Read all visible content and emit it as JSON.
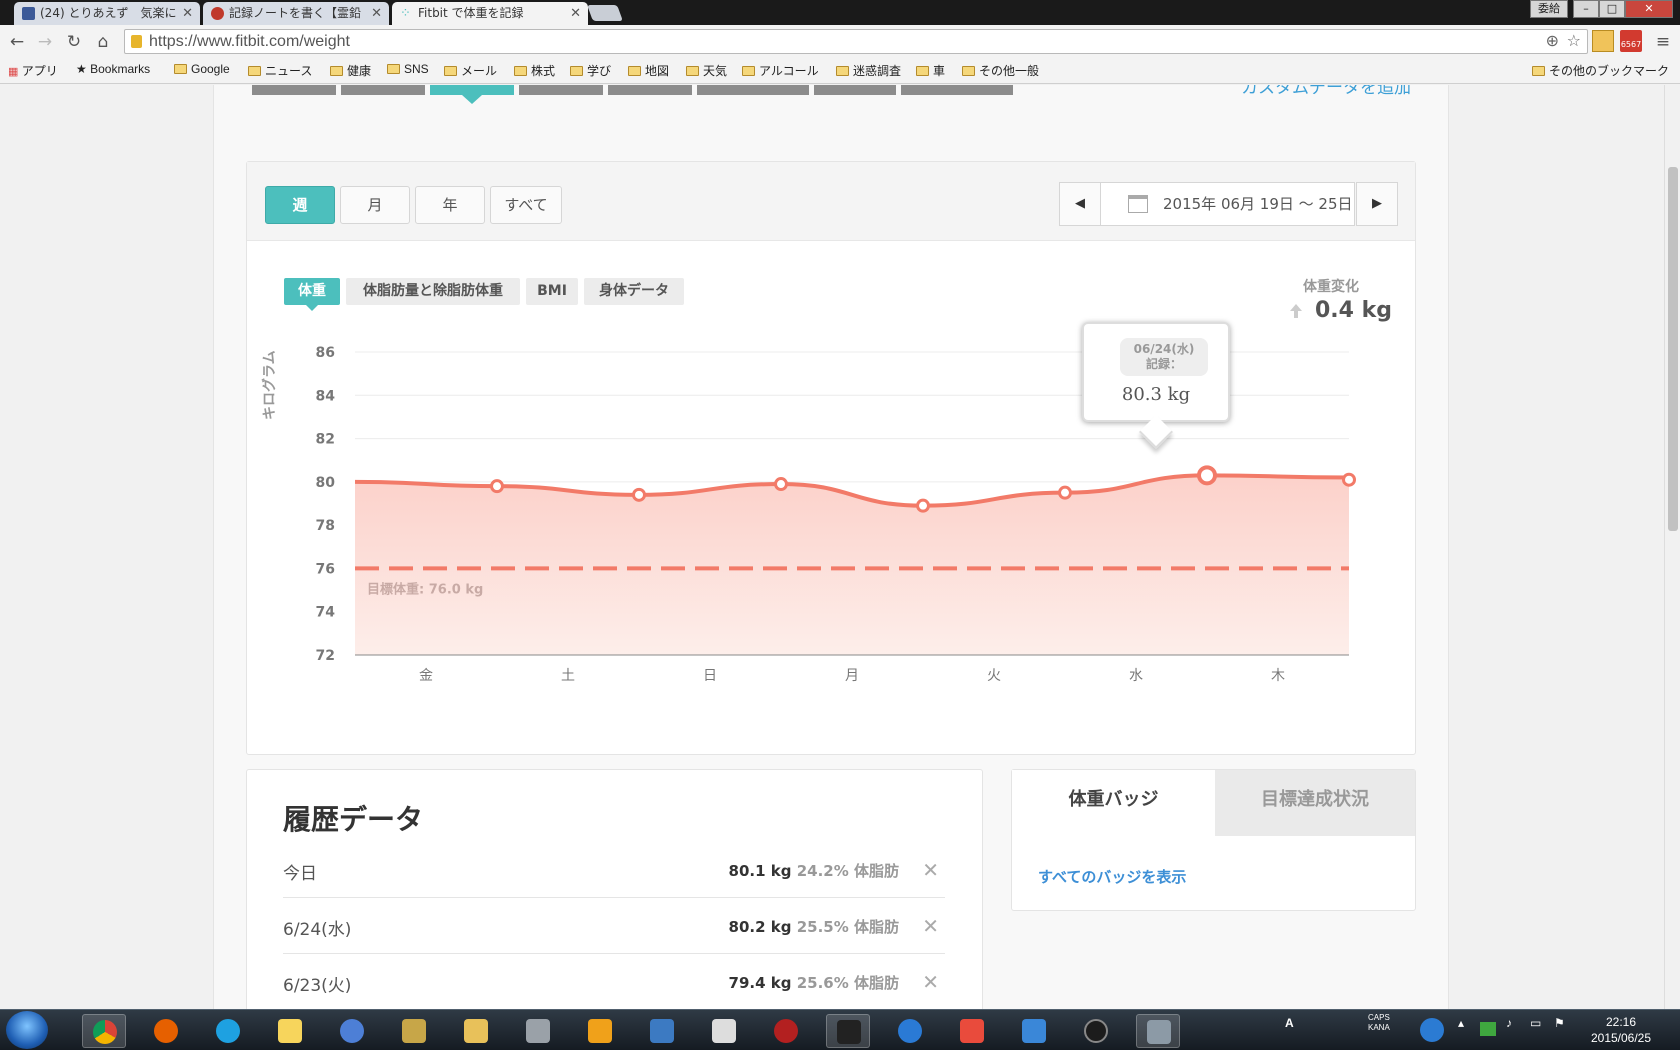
{
  "browser": {
    "tabs": [
      {
        "title": "(24) とりあえず　気楽に",
        "favicon_color": "#3b5998"
      },
      {
        "title": "記録ノートを書く【霊鉛",
        "favicon_color": "#c0392b"
      },
      {
        "title": "Fitbit で体重を記録",
        "favicon_color": "#4cbfbd"
      }
    ],
    "window_controls": {
      "ime": "委給",
      "minimize": "–",
      "maximize": "□",
      "close": "✕"
    },
    "url": "https://www.fitbit.com/weight",
    "gmail_badge": "6567",
    "bookmarks": [
      "アプリ",
      "Bookmarks",
      "Google",
      "ニュース",
      "健康",
      "SNS",
      "メール",
      "株式",
      "学び",
      "地図",
      "天気",
      "アルコール",
      "迷惑調査",
      "車",
      "その他一般"
    ],
    "other_bookmarks": "その他のブックマーク"
  },
  "page": {
    "custom_data_link": "カスタムデータを追加",
    "range_buttons": [
      "週",
      "月",
      "年",
      "すべて"
    ],
    "date_range": "2015年 06月 19日 ～ 25日",
    "prev_label": "◀",
    "next_label": "▶",
    "subtabs": [
      "体重",
      "体脂肪量と除脂肪体重",
      "BMI",
      "身体データ"
    ],
    "change_title": "体重変化",
    "change_value": "0.4 kg",
    "tooltip": {
      "date": "06/24(水)",
      "label": "記録：",
      "value": "80.3 kg"
    },
    "history": {
      "title": "履歴データ",
      "rows": [
        {
          "date": "今日",
          "weight": "80.1 kg",
          "fat": "24.2% 体脂肪"
        },
        {
          "date": "6/24(水)",
          "weight": "80.2 kg",
          "fat": "25.5% 体脂肪"
        },
        {
          "date": "6/23(火)",
          "weight": "79.4 kg",
          "fat": "25.6% 体脂肪"
        }
      ],
      "delete_icon": "✕"
    },
    "badges": {
      "tab_active": "体重バッジ",
      "tab_inactive": "目標達成状況",
      "link": "すべてのバッジを表示"
    }
  },
  "chart_data": {
    "type": "area",
    "ylabel": "キログラム",
    "yticks": [
      86,
      84,
      82,
      80,
      78,
      76,
      74,
      72
    ],
    "ylim": [
      72,
      86
    ],
    "categories": [
      "金",
      "土",
      "日",
      "月",
      "火",
      "水",
      "木"
    ],
    "series": [
      {
        "values": [
          80.0,
          79.8,
          79.4,
          79.9,
          78.9,
          79.5,
          80.3,
          80.2,
          80.1
        ],
        "x_positions": [
          0,
          0.5,
          1.5,
          2.5,
          3.5,
          4.5,
          5.5,
          6.5,
          7.0
        ],
        "markers": [
          false,
          true,
          true,
          true,
          true,
          true,
          true,
          false,
          true
        ]
      }
    ],
    "goal": {
      "value": 76.0,
      "label": "目標体重: 76.0 kg"
    },
    "color": "#f27a68",
    "fill_color": "#fcd1ca"
  },
  "taskbar": {
    "clock_time": "22:16",
    "clock_date": "2015/06/25",
    "tray_caps": "CAPS",
    "tray_kana": "KANA",
    "tray_ime": "A"
  }
}
